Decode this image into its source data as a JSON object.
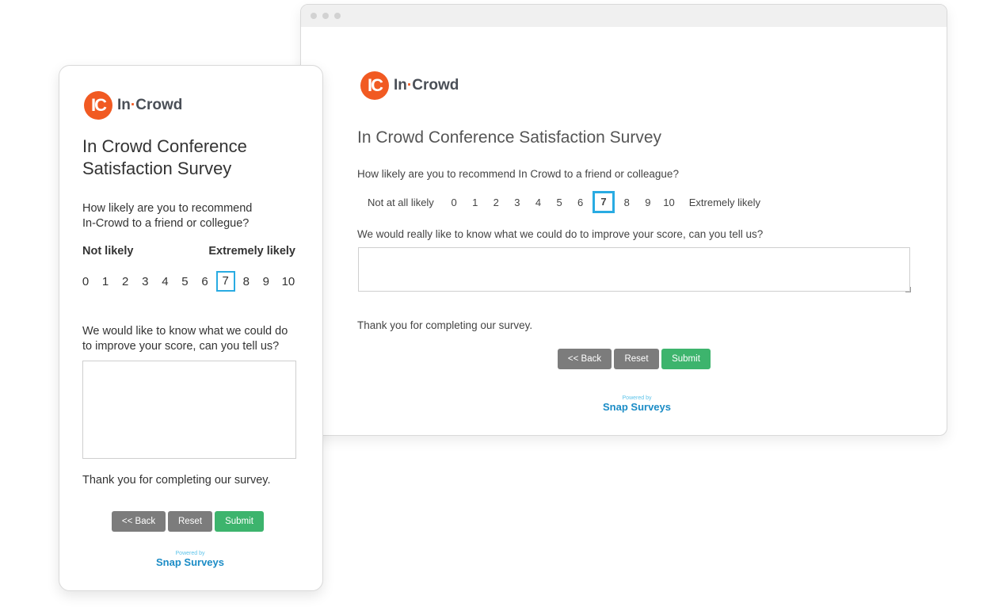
{
  "desktop": {
    "logo": {
      "badge": "IC",
      "name_part1": "In",
      "name_sep": "·",
      "name_part2": "Crowd"
    },
    "title": "In Crowd Conference Satisfaction Survey",
    "question1": "How likely are you to recommend In Crowd to a friend or colleague?",
    "scale": {
      "low_label": "Not at all likely",
      "high_label": "Extremely likely",
      "options": [
        "0",
        "1",
        "2",
        "3",
        "4",
        "5",
        "6",
        "7",
        "8",
        "9",
        "10"
      ],
      "selected": "7"
    },
    "question2": "We would really like to know what we could do to improve your score, can you tell us?",
    "comment_value": "",
    "thanks": "Thank you for completing our survey.",
    "buttons": {
      "back": "<< Back",
      "reset": "Reset",
      "submit": "Submit"
    },
    "powered_by": "Powered by",
    "brand": "Snap Surveys"
  },
  "mobile": {
    "logo": {
      "badge": "IC",
      "name_part1": "In",
      "name_sep": "·",
      "name_part2": "Crowd"
    },
    "title_line1": "In Crowd Conference",
    "title_line2": "Satisfaction Survey",
    "question1_line1": "How likely are you to recommend",
    "question1_line2": "In-Crowd to a friend or collegue?",
    "scale": {
      "low_label": "Not likely",
      "high_label": "Extremely likely",
      "options": [
        "0",
        "1",
        "2",
        "3",
        "4",
        "5",
        "6",
        "7",
        "8",
        "9",
        "10"
      ],
      "selected": "7"
    },
    "question2_line1": "We would like to know what we could do",
    "question2_line2": "to improve your score, can you tell us?",
    "comment_value": "",
    "thanks": "Thank you for completing our survey.",
    "buttons": {
      "back": "<< Back",
      "reset": "Reset",
      "submit": "Submit"
    },
    "powered_by": "Powered by",
    "brand": "Snap Surveys"
  },
  "colors": {
    "brand_orange": "#f15a22",
    "selected_border": "#29abe2",
    "button_grey": "#7c7c7c",
    "button_green": "#3db46d",
    "snap_blue": "#1b8cc6"
  }
}
